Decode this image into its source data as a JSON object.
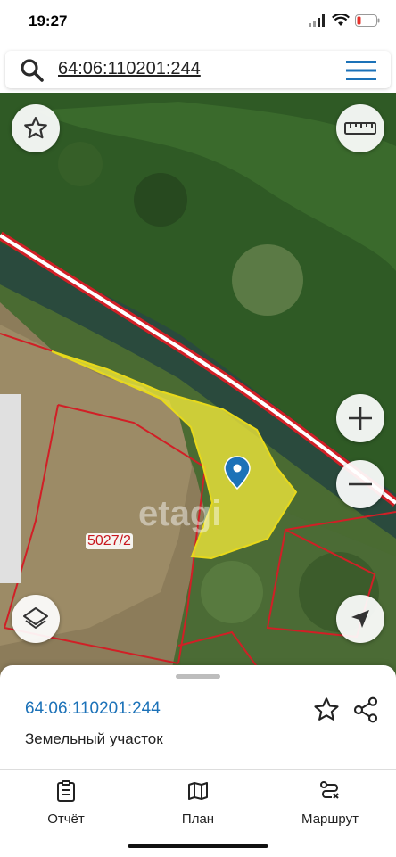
{
  "status": {
    "time": "19:27"
  },
  "search": {
    "query": "64:06:110201:244"
  },
  "map": {
    "parcel_label": "5027/2",
    "watermark": "etagi",
    "colors": {
      "highlight": "#f2e93a",
      "boundary": "#d11f26",
      "pin": "#1c72b8"
    },
    "buttons": [
      "favorite",
      "ruler",
      "zoom-in",
      "zoom-out",
      "layers",
      "locate"
    ]
  },
  "sheet": {
    "cadastral_number": "64:06:110201:244",
    "parcel_type": "Земельный участок"
  },
  "tabs": [
    {
      "label": "Отчёт",
      "icon": "report-icon"
    },
    {
      "label": "План",
      "icon": "map-icon"
    },
    {
      "label": "Маршрут",
      "icon": "route-icon"
    }
  ]
}
